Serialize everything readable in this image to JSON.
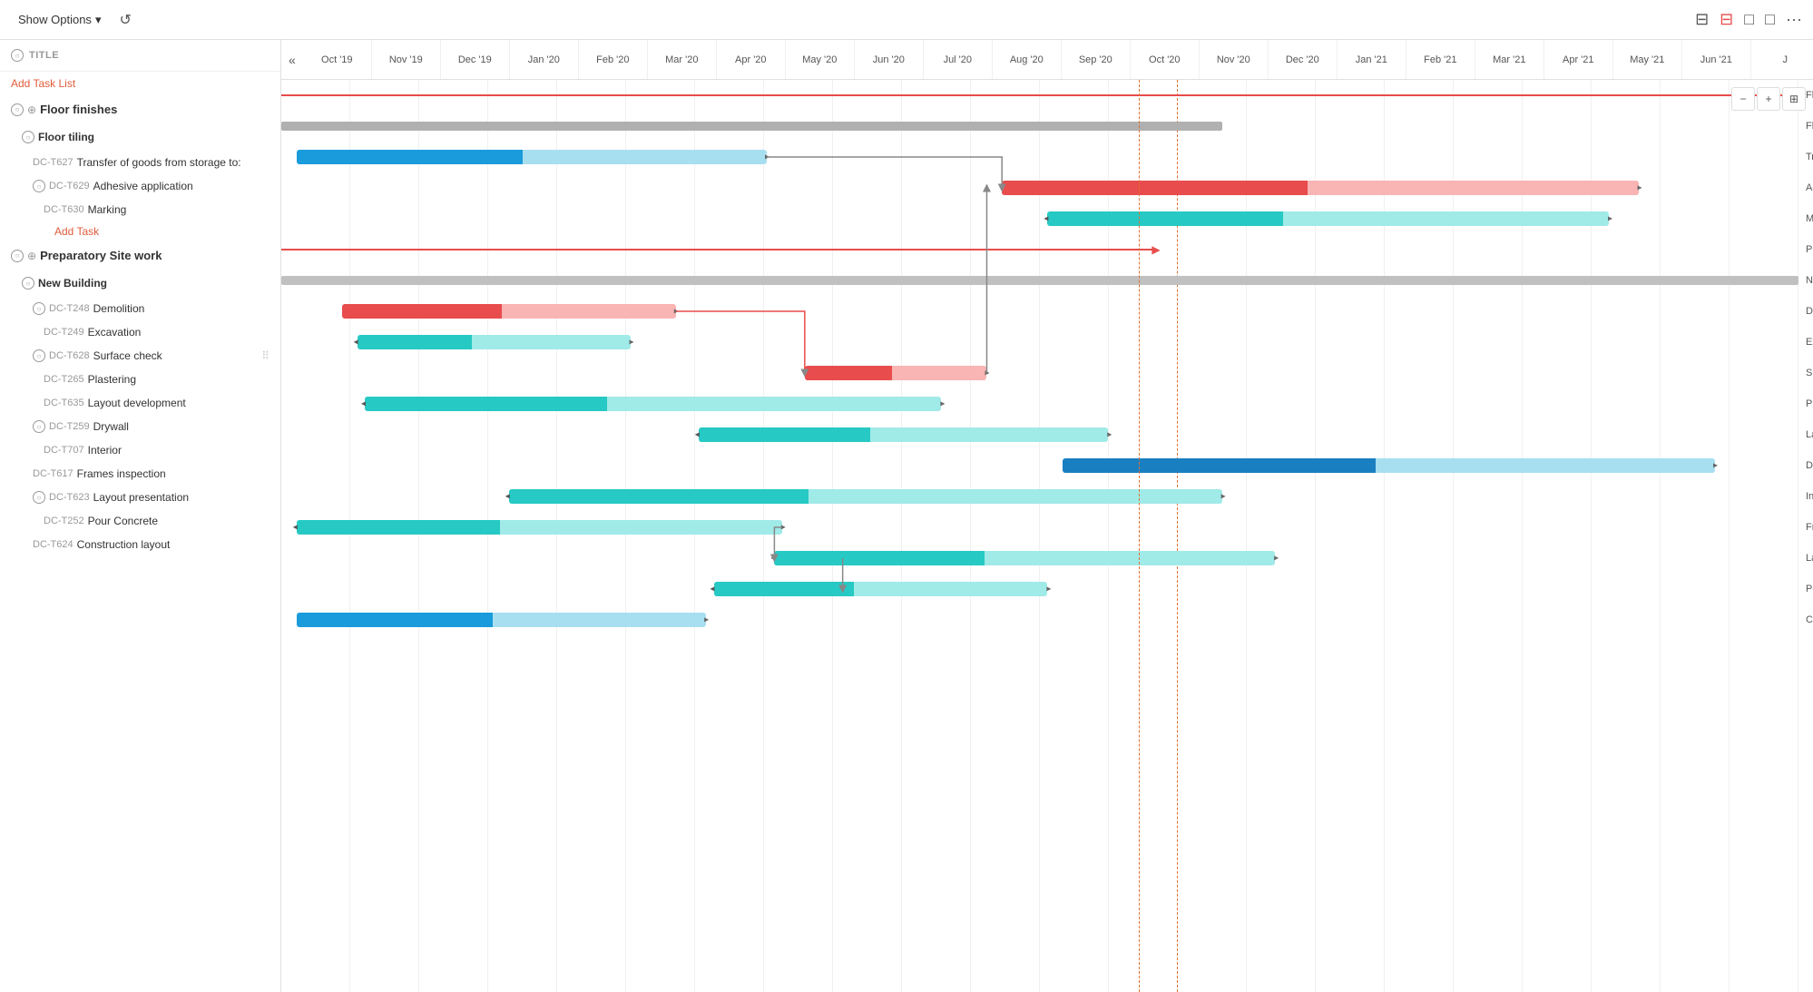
{
  "toolbar": {
    "show_options_label": "Show Options",
    "undo_icon": "↺",
    "chevron_icon": "⌄",
    "icons": [
      "⊟",
      "⊟",
      "□",
      "□",
      "···"
    ]
  },
  "left_panel": {
    "title": "TITLE",
    "add_task_list": "Add Task List",
    "add_task": "Add Task",
    "sections": [
      {
        "name": "Floor finishes",
        "level": 1,
        "children": [
          {
            "name": "Floor tiling",
            "level": 2,
            "children": [
              {
                "code": "DC-T627",
                "name": "Transfer of goods from storage to:",
                "level": 3
              },
              {
                "code": "DC-T629",
                "name": "Adhesive application",
                "level": 3,
                "expandable": true
              },
              {
                "code": "DC-T630",
                "name": "Marking",
                "level": 4
              }
            ]
          }
        ]
      },
      {
        "name": "Preparatory Site work",
        "level": 1,
        "children": [
          {
            "name": "New Building",
            "level": 2,
            "children": [
              {
                "code": "DC-T248",
                "name": "Demolition",
                "level": 3,
                "expandable": true
              },
              {
                "code": "DC-T249",
                "name": "Excavation",
                "level": 4
              },
              {
                "code": "DC-T628",
                "name": "Surface check",
                "level": 3,
                "expandable": true
              },
              {
                "code": "DC-T265",
                "name": "Plastering",
                "level": 4
              },
              {
                "code": "DC-T635",
                "name": "Layout development",
                "level": 4
              },
              {
                "code": "DC-T259",
                "name": "Drywall",
                "level": 3,
                "expandable": true
              },
              {
                "code": "DC-T707",
                "name": "Interior",
                "level": 4
              },
              {
                "code": "DC-T617",
                "name": "Frames inspection",
                "level": 3
              },
              {
                "code": "DC-T623",
                "name": "Layout presentation",
                "level": 3,
                "expandable": true
              },
              {
                "code": "DC-T252",
                "name": "Pour Concrete",
                "level": 4
              },
              {
                "code": "DC-T624",
                "name": "Construction layout",
                "level": 3
              }
            ]
          }
        ]
      }
    ]
  },
  "gantt": {
    "months": [
      "Oct '19",
      "Nov '19",
      "Dec '19",
      "Jan '20",
      "Feb '20",
      "Mar '20",
      "Apr '20",
      "May '20",
      "Jun '20",
      "Jul '20",
      "Aug '20",
      "Sep '20",
      "Oct '20",
      "Nov '20",
      "Dec '20",
      "Jan '21",
      "Feb '21",
      "Mar '21",
      "Apr '21",
      "May '21",
      "Jun '21",
      "J"
    ],
    "today_position_pct": 56.5,
    "bars": {
      "floor_finishes_summary": {
        "label": "Floor finishes",
        "start_pct": 0,
        "width_pct": 100
      },
      "floor_tiling_summary": {
        "label": "Floor tiling",
        "start_pct": 0,
        "width_pct": 62
      },
      "transfer_goods": {
        "label": "Transfer of goods from storage to site.",
        "start_pct": 1,
        "width_pct": 30
      },
      "adhesive_app": {
        "label": "Adhesive application",
        "start_pct": 48,
        "width_pct": 42
      },
      "marking": {
        "label": "Marking",
        "start_pct": 51,
        "width_pct": 36
      },
      "prep_site_summary": {
        "label": "Preparatory Site work",
        "start_pct": 0,
        "width_pct": 58
      },
      "new_building_summary": {
        "label": "New Building",
        "start_pct": 0,
        "width_pct": 100
      },
      "demolition": {
        "label": "Demolition",
        "start_pct": 4,
        "width_pct": 22
      },
      "excavation": {
        "label": "Excavation",
        "start_pct": 5,
        "width_pct": 18
      },
      "surface_check": {
        "label": "Surface check",
        "start_pct": 35,
        "width_pct": 13
      },
      "plastering": {
        "label": "Plastering",
        "start_pct": 5,
        "width_pct": 38
      },
      "layout_dev": {
        "label": "Layout development",
        "start_pct": 28,
        "width_pct": 26
      },
      "drywall": {
        "label": "Drywall",
        "start_pct": 52,
        "width_pct": 42
      },
      "interior": {
        "label": "Interior",
        "start_pct": 15,
        "width_pct": 46
      },
      "frames_inspection": {
        "label": "Frames inspection",
        "start_pct": 1,
        "width_pct": 30
      },
      "layout_presentation": {
        "label": "Layout presentation",
        "start_pct": 33,
        "width_pct": 33
      },
      "pour_concrete": {
        "label": "Pour Concrete",
        "start_pct": 29,
        "width_pct": 22
      },
      "construction_layout": {
        "label": "Construction layout",
        "start_pct": 1,
        "width_pct": 26
      }
    }
  }
}
